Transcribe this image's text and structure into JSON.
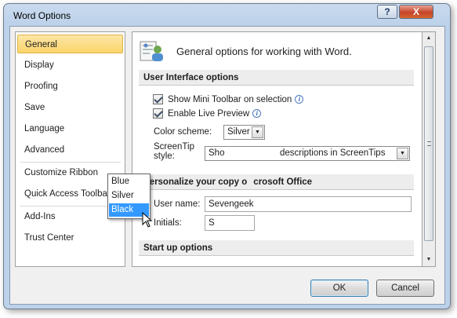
{
  "window": {
    "title": "Word Options",
    "help_label": "?",
    "close_label": "X"
  },
  "sidebar": {
    "items": [
      {
        "label": "General",
        "selected": true
      },
      {
        "label": "Display"
      },
      {
        "label": "Proofing"
      },
      {
        "label": "Save"
      },
      {
        "label": "Language"
      },
      {
        "label": "Advanced"
      },
      {
        "label": "Customize Ribbon"
      },
      {
        "label": "Quick Access Toolbar"
      },
      {
        "label": "Add-Ins"
      },
      {
        "label": "Trust Center"
      }
    ]
  },
  "content": {
    "header": "General options for working with Word.",
    "ui_section": {
      "title": "User Interface options",
      "mini_toolbar_label": "Show Mini Toolbar on selection",
      "live_preview_label": "Enable Live Preview",
      "info_glyph": "i",
      "color_scheme_label": "Color scheme:",
      "color_scheme_value": "Silver",
      "color_scheme_options": [
        "Blue",
        "Silver",
        "Black"
      ],
      "color_scheme_highlighted": "Black",
      "screentip_label_line1": "ScreenTip",
      "screentip_label_line2": "style:",
      "screentip_value_left": "Sho",
      "screentip_value_right": "descriptions in ScreenTips"
    },
    "personalize_section": {
      "title_left": "Personalize your copy o",
      "title_right": "crosoft Office",
      "username_label": "User name:",
      "username_value": "Sevengeek",
      "initials_label": "Initials:",
      "initials_value": "S"
    },
    "startup_section": {
      "title": "Start up options"
    }
  },
  "footer": {
    "ok_label": "OK",
    "cancel_label": "Cancel"
  },
  "colors": {
    "selection_highlight": "#3399ff",
    "nav_selected": "#fbd46b"
  }
}
